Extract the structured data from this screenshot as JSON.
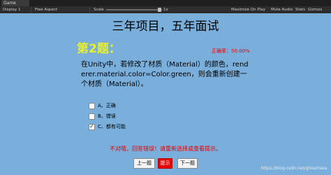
{
  "editor": {
    "tab_label": "Game",
    "display_label": "Display 1",
    "aspect_label": "Free Aspect",
    "scale_label": "Scale",
    "scale_value": "1x",
    "maximize_label": "Maximize On Play",
    "mute_label": "Mute Audio",
    "stats_label": "Stats",
    "gizmos_label": "Gizmos"
  },
  "quiz": {
    "title": "三年项目，五年面试",
    "question_number": "第2题：",
    "accuracy": "正确率：50.00%",
    "question": "在Unity中，若修改了材质（Material）的颜色，renderer.material.color=Color.green，则会重新创建一个材质（Material）。",
    "options": [
      {
        "label": "A、正确",
        "checked": false
      },
      {
        "label": "B、错误",
        "checked": false
      },
      {
        "label": "C、都有可能",
        "checked": true
      }
    ],
    "feedback": "不对哦，回答错误！请重新选择或查看提示。",
    "prev_button": "上一题",
    "hint_button": "提示",
    "next_button": "下一题"
  },
  "watermark": "https://blog.csdn.net/gheartsea",
  "colors": {
    "background": "#7aaedb",
    "title_color": "#000000",
    "question_number_color": "#e8ef2e",
    "accent_red": "#e60000"
  }
}
